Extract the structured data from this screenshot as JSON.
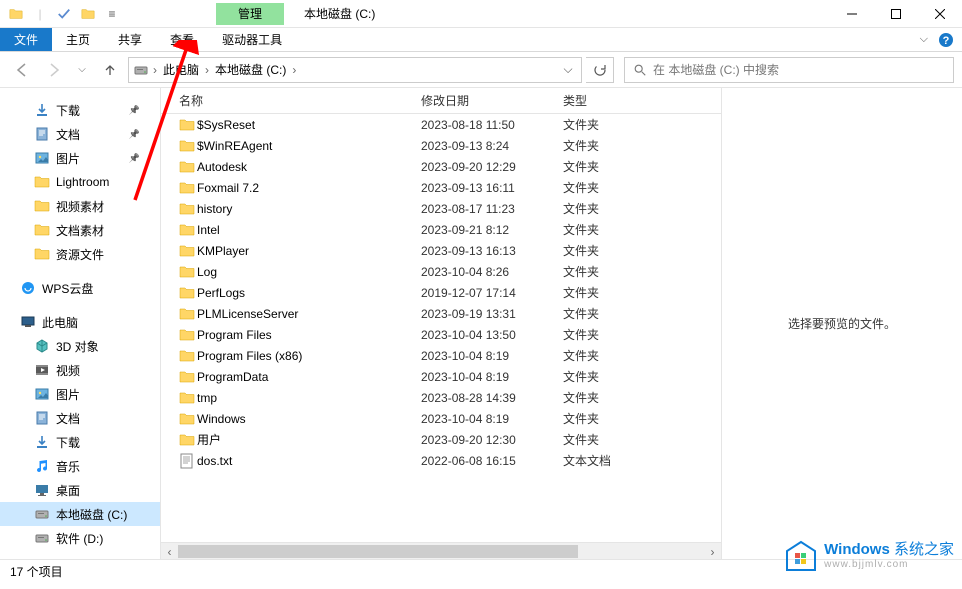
{
  "titlebar": {
    "drive_tools_label": "管理",
    "window_title": "本地磁盘 (C:)"
  },
  "tabs": {
    "file": "文件",
    "home": "主页",
    "share": "共享",
    "view": "查看",
    "drive_tools": "驱动器工具"
  },
  "address": {
    "seg_thispc": "此电脑",
    "seg_drive": "本地磁盘 (C:)"
  },
  "search": {
    "placeholder": "在 本地磁盘 (C:) 中搜索"
  },
  "sidebar_quick": [
    {
      "label": "下载",
      "icon": "download",
      "pinned": true
    },
    {
      "label": "文档",
      "icon": "document",
      "pinned": true
    },
    {
      "label": "图片",
      "icon": "picture",
      "pinned": true
    },
    {
      "label": "Lightroom",
      "icon": "folder",
      "pinned": false
    },
    {
      "label": "视频素材",
      "icon": "folder",
      "pinned": false
    },
    {
      "label": "文档素材",
      "icon": "folder",
      "pinned": false
    },
    {
      "label": "资源文件",
      "icon": "folder",
      "pinned": false
    }
  ],
  "sidebar_wps": {
    "label": "WPS云盘"
  },
  "sidebar_thispc": {
    "label": "此电脑"
  },
  "sidebar_pc_children": [
    {
      "label": "3D 对象",
      "icon": "3d"
    },
    {
      "label": "视频",
      "icon": "video"
    },
    {
      "label": "图片",
      "icon": "picture"
    },
    {
      "label": "文档",
      "icon": "document"
    },
    {
      "label": "下载",
      "icon": "download"
    },
    {
      "label": "音乐",
      "icon": "music"
    },
    {
      "label": "桌面",
      "icon": "desktop"
    },
    {
      "label": "本地磁盘 (C:)",
      "icon": "drive",
      "selected": true
    },
    {
      "label": "软件 (D:)",
      "icon": "drive"
    }
  ],
  "columns": {
    "name": "名称",
    "date": "修改日期",
    "type": "类型"
  },
  "files": [
    {
      "name": "$SysReset",
      "date": "2023-08-18 11:50",
      "type": "文件夹",
      "icon": "folder"
    },
    {
      "name": "$WinREAgent",
      "date": "2023-09-13 8:24",
      "type": "文件夹",
      "icon": "folder"
    },
    {
      "name": "Autodesk",
      "date": "2023-09-20 12:29",
      "type": "文件夹",
      "icon": "folder"
    },
    {
      "name": "Foxmail 7.2",
      "date": "2023-09-13 16:11",
      "type": "文件夹",
      "icon": "folder"
    },
    {
      "name": "history",
      "date": "2023-08-17 11:23",
      "type": "文件夹",
      "icon": "folder"
    },
    {
      "name": "Intel",
      "date": "2023-09-21 8:12",
      "type": "文件夹",
      "icon": "folder"
    },
    {
      "name": "KMPlayer",
      "date": "2023-09-13 16:13",
      "type": "文件夹",
      "icon": "folder"
    },
    {
      "name": "Log",
      "date": "2023-10-04 8:26",
      "type": "文件夹",
      "icon": "folder"
    },
    {
      "name": "PerfLogs",
      "date": "2019-12-07 17:14",
      "type": "文件夹",
      "icon": "folder"
    },
    {
      "name": "PLMLicenseServer",
      "date": "2023-09-19 13:31",
      "type": "文件夹",
      "icon": "folder"
    },
    {
      "name": "Program Files",
      "date": "2023-10-04 13:50",
      "type": "文件夹",
      "icon": "folder"
    },
    {
      "name": "Program Files (x86)",
      "date": "2023-10-04 8:19",
      "type": "文件夹",
      "icon": "folder"
    },
    {
      "name": "ProgramData",
      "date": "2023-10-04 8:19",
      "type": "文件夹",
      "icon": "folder"
    },
    {
      "name": "tmp",
      "date": "2023-08-28 14:39",
      "type": "文件夹",
      "icon": "folder"
    },
    {
      "name": "Windows",
      "date": "2023-10-04 8:19",
      "type": "文件夹",
      "icon": "folder"
    },
    {
      "name": "用户",
      "date": "2023-09-20 12:30",
      "type": "文件夹",
      "icon": "folder"
    },
    {
      "name": "dos.txt",
      "date": "2022-06-08 16:15",
      "type": "文本文档",
      "icon": "textfile"
    }
  ],
  "preview_empty": "选择要预览的文件。",
  "status": {
    "item_count": "17 个项目"
  },
  "watermark": {
    "main_bold": "Windows",
    "main_rest": " 系统之家",
    "sub": "www.bjjmlv.com"
  }
}
